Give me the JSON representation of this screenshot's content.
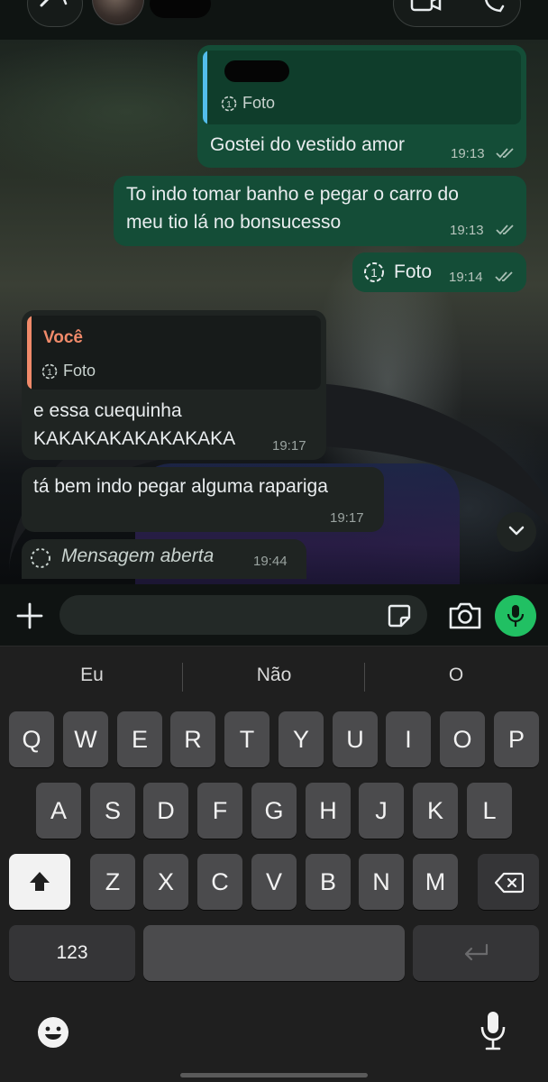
{
  "chat": {
    "messages": [
      {
        "quote_author": "",
        "quote_label": "Foto",
        "text": "Gostei do vestido amor",
        "time": "19:13"
      },
      {
        "text_line1": "To indo tomar banho e pegar o carro do",
        "text_line2": "meu tio lá no bonsucesso",
        "time": "19:13"
      },
      {
        "label": "Foto",
        "time": "19:14"
      },
      {
        "quote_author": "Você",
        "quote_label": "Foto",
        "text_line1": "e essa cuequinha",
        "text_line2": "KAKAKAKAKAKAKAKA",
        "time": "19:17"
      },
      {
        "text": "tá bem indo pegar alguma rapariga",
        "time": "19:17"
      },
      {
        "text": "Mensagem aberta",
        "time": "19:44"
      }
    ]
  },
  "composer": {
    "placeholder": ""
  },
  "keyboard": {
    "suggestions": [
      "Eu",
      "Não",
      "O"
    ],
    "row1": [
      "Q",
      "W",
      "E",
      "R",
      "T",
      "Y",
      "U",
      "I",
      "O",
      "P"
    ],
    "row2": [
      "A",
      "S",
      "D",
      "F",
      "G",
      "H",
      "J",
      "K",
      "L"
    ],
    "row3": [
      "Z",
      "X",
      "C",
      "V",
      "B",
      "N",
      "M"
    ],
    "numbers_label": "123"
  },
  "colors": {
    "outgoing": "#144d37",
    "incoming": "#1f2422",
    "accent": "#21c063",
    "quote_you": "#f08a6a",
    "quote_bar_out": "#53bdeb"
  },
  "icons": [
    "back-chevron-icon",
    "video-call-icon",
    "phone-icon",
    "view-once-icon",
    "read-ticks-icon",
    "chevron-down-icon",
    "plus-icon",
    "sticker-icon",
    "camera-icon",
    "mic-icon",
    "shift-icon",
    "backspace-icon",
    "return-icon",
    "emoji-icon",
    "dictation-mic-icon"
  ]
}
